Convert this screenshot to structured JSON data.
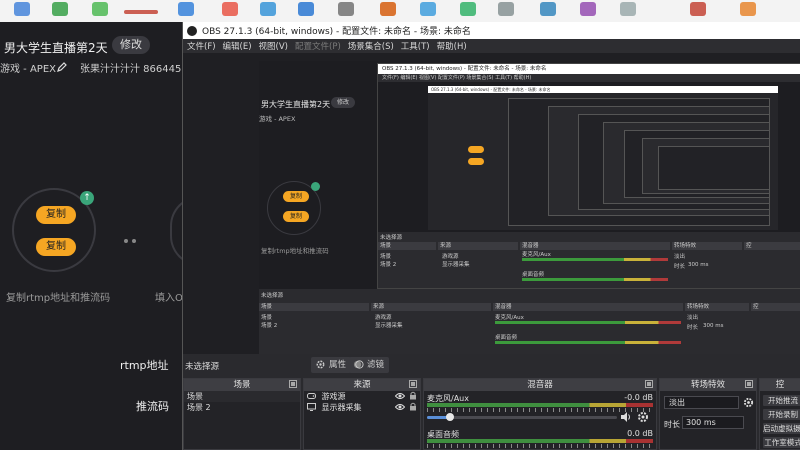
{
  "background_app": {
    "title": "男大学生直播第2天",
    "edit_label": "修改",
    "subtitle": "游戏 - APEX",
    "subtitle_extra": "张果汁汁汁汁  866445",
    "pill_top": "复制",
    "pill_bottom": "复制",
    "badge": "↑",
    "caption": "复制rtmp地址和推流码",
    "partial_caption": "填入O",
    "rtmp_label": "rtmp地址",
    "push_label": "推流码"
  },
  "obs": {
    "window_title": "OBS 27.1.3 (64-bit, windows) - 配置文件: 未命名 - 场景: 未命名",
    "menu": [
      "文件(F)",
      "编辑(E)",
      "视图(V)",
      "配置文件(P)",
      "场景集合(S)",
      "工具(T)",
      "帮助(H)"
    ],
    "no_source": "未选择源",
    "properties_btn": "属性",
    "filters_btn": "滤镜",
    "panels": {
      "scenes": {
        "title": "场景",
        "items": [
          "场景",
          "场景 2"
        ]
      },
      "sources": {
        "title": "来源",
        "items": [
          "游戏源",
          "显示器采集"
        ]
      },
      "mixer": {
        "title": "混音器",
        "channels": [
          {
            "name": "麦克风/Aux",
            "db": "-0.0 dB"
          },
          {
            "name": "桌面音频",
            "db": "0.0 dB"
          }
        ],
        "scale": [
          "-60",
          "-55",
          "-50",
          "-45",
          "-40",
          "-35",
          "-30",
          "-25",
          "-20",
          "-15",
          "-10",
          "-5",
          "0"
        ]
      },
      "transitions": {
        "title": "转场特效",
        "selected": "淡出",
        "duration_label": "时长",
        "duration_value": "300 ms"
      },
      "controls": {
        "title": "控",
        "buttons": [
          "开始推流",
          "开始录制",
          "启动虚拟摄像机",
          "工作室模式"
        ]
      }
    }
  },
  "nested": {
    "title_small": "OBS 27.1.3 (64-bit, windows) - 配置文件: 未命名 - 场景: 未命名",
    "menu_small": "文件(F)  编辑(E)  视图(V)  配置文件(P)  场景集合(S)  工具(T)  帮助(H)",
    "scene_items": [
      "场景",
      "场景 2"
    ],
    "source_items": [
      "游戏源",
      "显示器采集"
    ],
    "mixer_channels": [
      "麦克风/Aux",
      "桌面音频"
    ],
    "no_source": "未选择源",
    "transition": "淡出",
    "duration_label": "时长",
    "duration": "300 ms"
  }
}
